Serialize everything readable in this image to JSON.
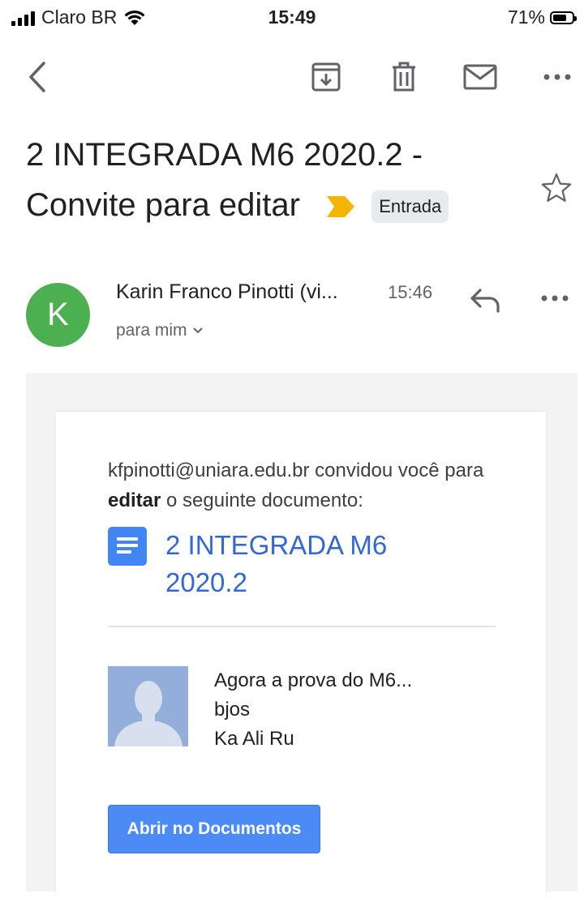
{
  "status_bar": {
    "carrier": "Claro BR",
    "time": "15:49",
    "battery": "71%",
    "battery_level": 0.71
  },
  "toolbar": {
    "icons": [
      "back-icon",
      "archive-icon",
      "trash-icon",
      "mail-icon",
      "more-icon"
    ]
  },
  "email": {
    "subject": "2 INTEGRADA M6 2020.2 - Convite para editar",
    "label": "Entrada",
    "label_color": "#f4b400",
    "sender": {
      "initial": "K",
      "name": "Karin Franco Pinotti (vi...",
      "time": "15:46",
      "recipient": "para mim",
      "avatar_color": "#4caf50"
    },
    "body": {
      "invite_prefix": "kfpinotti@uniara.edu.br convidou você para",
      "invite_bold": "editar",
      "invite_suffix": "o seguinte documento:",
      "document_title": "2 INTEGRADA M6 2020.2",
      "message_lines": [
        "Agora a prova do M6...",
        "bjos",
        "Ka Ali Ru"
      ],
      "button_label": "Abrir no Documentos",
      "link_color": "#3367d6",
      "button_color": "#4c8bf5"
    }
  }
}
